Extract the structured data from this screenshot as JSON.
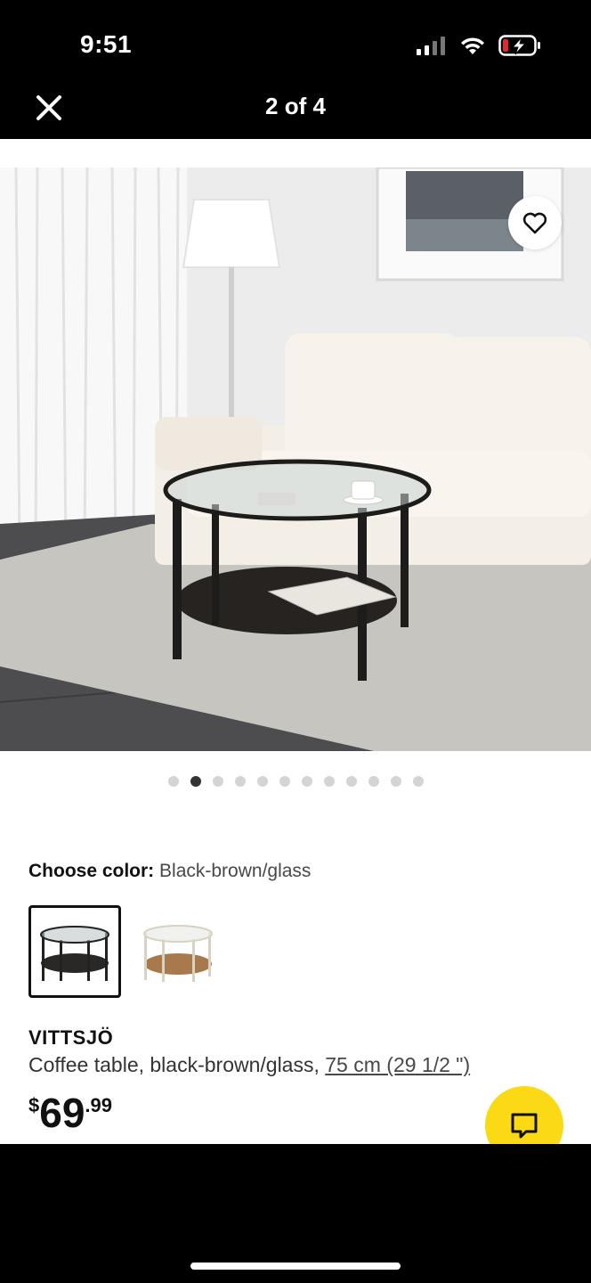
{
  "status": {
    "time": "9:51"
  },
  "header": {
    "title": "2 of 4"
  },
  "gallery": {
    "dot_count": 12,
    "active_dot": 1
  },
  "product": {
    "color_label": "Choose color:",
    "color_value": "Black-brown/glass",
    "name": "VITTSJÖ",
    "description": "Coffee table, black-brown/glass, ",
    "measurement": "75 cm (29 1/2 \")",
    "price_currency": "$",
    "price_int": "69",
    "price_dec": ".99"
  },
  "colors": {
    "chat": "#fbd914",
    "battery_warning": "#e0282d"
  }
}
